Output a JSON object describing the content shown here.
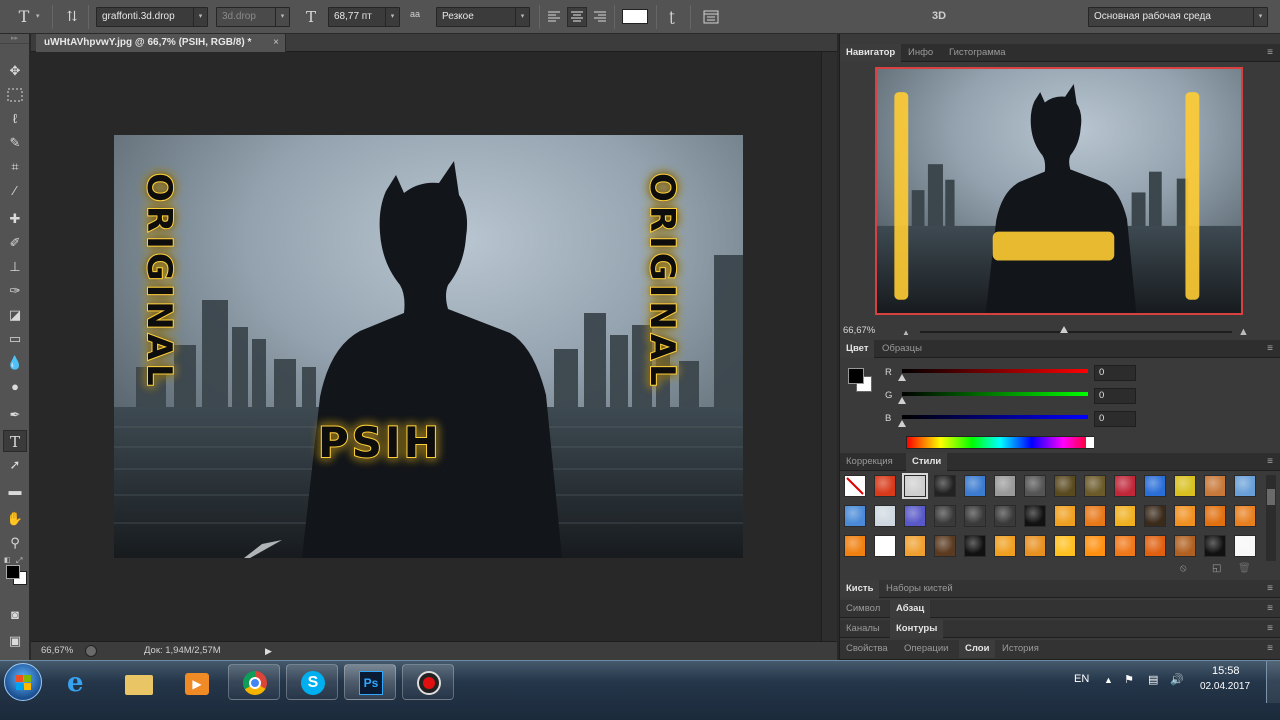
{
  "options_bar": {
    "font_family": "graffonti.3d.drop",
    "font_style": "3d.drop",
    "font_size": "68,77 пт",
    "anti_alias": "Резкое",
    "mode_3d": "3D",
    "workspace": "Основная рабочая среда"
  },
  "document": {
    "tab_title": "uWHtAVhpvwY.jpg @ 66,7% (PSIH, RGB/8) *",
    "tab_close": "×",
    "zoom": "66,67%",
    "doc_size": "Док: 1,94M/2,57M"
  },
  "canvas_art": {
    "left_vertical": "ORIGINAL",
    "right_vertical": "ORIGINAL",
    "center": "PSIH"
  },
  "panels": {
    "navigator_group": {
      "tabs": [
        "Навигатор",
        "Инфо",
        "Гистограмма"
      ],
      "active": 0,
      "zoom": "66,67%"
    },
    "color_group": {
      "tabs": [
        "Цвет",
        "Образцы"
      ],
      "active": 0,
      "channels": [
        {
          "label": "R",
          "value": "0"
        },
        {
          "label": "G",
          "value": "0"
        },
        {
          "label": "B",
          "value": "0"
        }
      ]
    },
    "styles_group": {
      "tabs": [
        "Коррекция",
        "Стили"
      ],
      "active": 1
    },
    "collapsed_groups": [
      {
        "tabs": [
          "Кисть",
          "Наборы кистей"
        ],
        "active": 0
      },
      {
        "tabs": [
          "Символ",
          "Абзац"
        ],
        "active": 1
      },
      {
        "tabs": [
          "Каналы",
          "Контуры"
        ],
        "active": 1
      },
      {
        "tabs": [
          "Свойства",
          "Операции",
          "Слои",
          "История"
        ],
        "active": 2
      }
    ]
  },
  "taskbar": {
    "language": "EN",
    "time": "15:58",
    "date": "02.04.2017",
    "apps": [
      "internet-explorer",
      "file-explorer",
      "media-player",
      "chrome",
      "skype",
      "photoshop",
      "recorder"
    ],
    "photoshop_label": "Ps"
  },
  "colors": {
    "app_bg": "#282828",
    "panel_bg": "#3a3a3a",
    "bar_bg": "#535353",
    "nav_frame": "#d94040",
    "graffiti_glow": "#ffb21e"
  }
}
